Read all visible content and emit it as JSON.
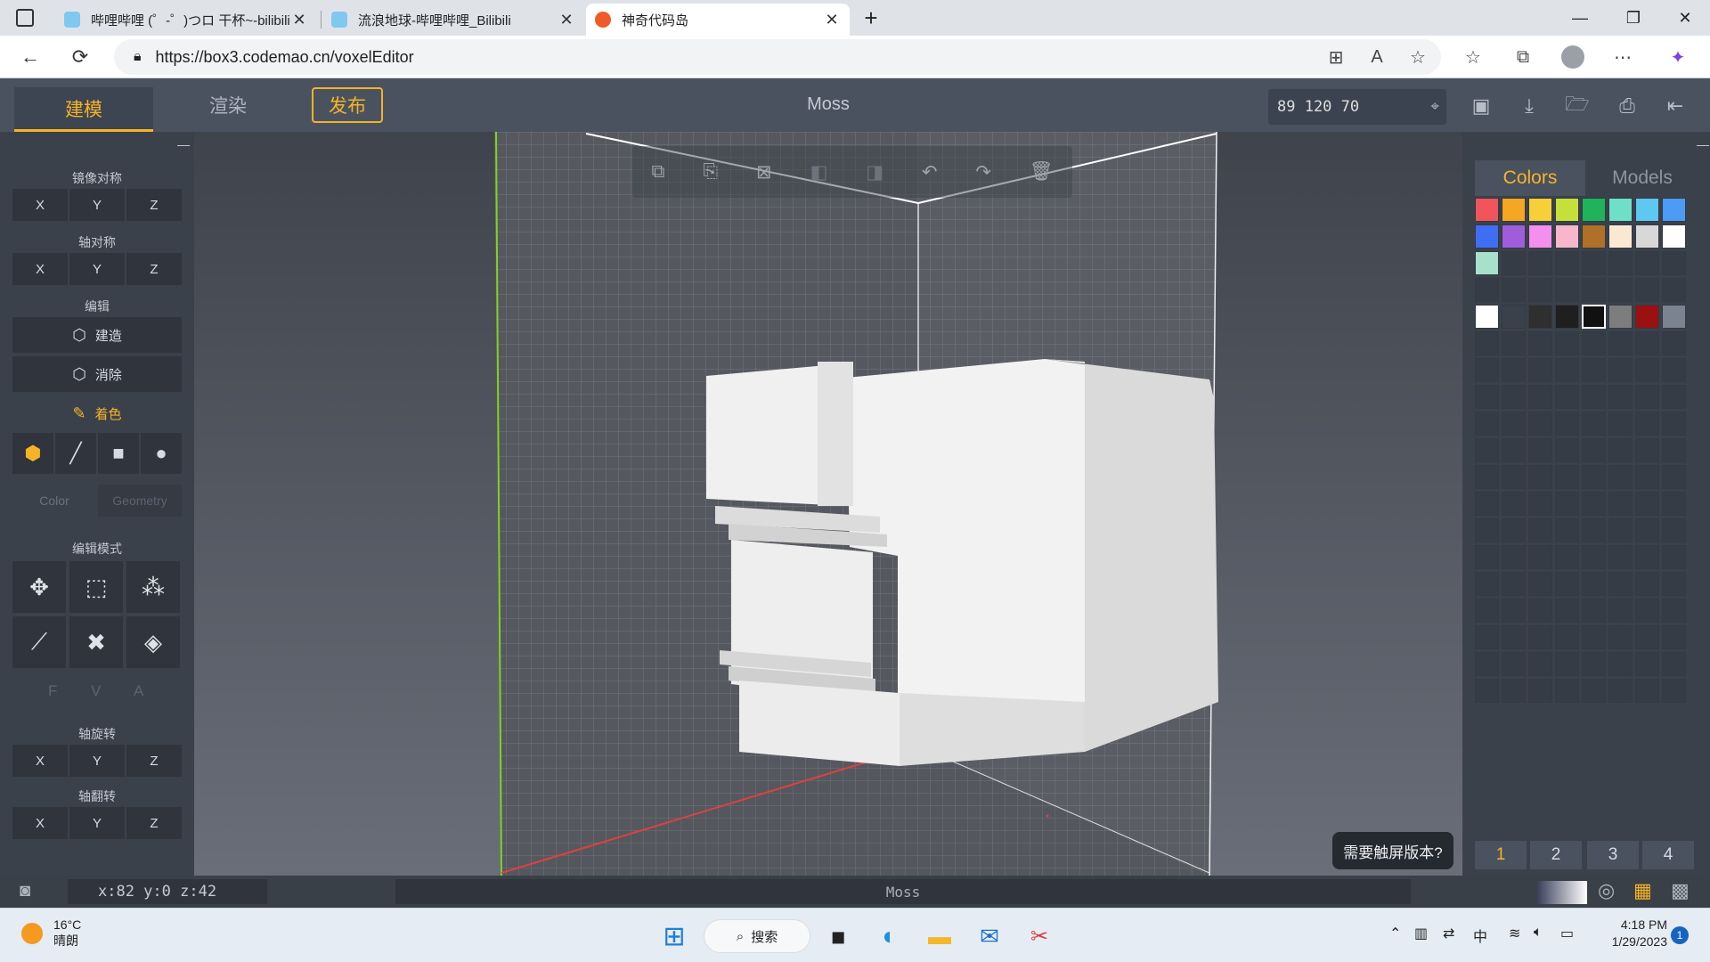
{
  "browser": {
    "tabs": [
      {
        "label": "哔哩哔哩 (゜-゜)つロ 干杯~-bilibili",
        "icon": "bilibili-tv-icon"
      },
      {
        "label": "流浪地球-哔哩哔哩_Bilibili",
        "icon": "bilibili-tv-icon"
      },
      {
        "label": "神奇代码岛",
        "icon": "codemao-star-icon",
        "active": true
      }
    ],
    "new_tab": "+",
    "url": "https://box3.codemao.cn/voxelEditor"
  },
  "app": {
    "modes": {
      "build": "建模",
      "render": "渲染",
      "publish": "发布"
    },
    "project_name": "Moss",
    "cursor_coords": "89 120 70",
    "accent": "#f5b325"
  },
  "left": {
    "mirror_title": "镜像对称",
    "axis_sym_title": "轴对称",
    "edit_title": "编辑",
    "build": "建造",
    "erase": "消除",
    "paint": "着色",
    "brush_labels": {
      "color": "Color",
      "geometry": "Geometry"
    },
    "edit_mode_title": "编辑模式",
    "fva": [
      "F",
      "V",
      "A"
    ],
    "rotate_title": "轴旋转",
    "flip_title": "轴翻转",
    "axes": [
      "X",
      "Y",
      "Z"
    ]
  },
  "right": {
    "tabs": {
      "colors": "Colors",
      "models": "Models"
    },
    "palette_row1": [
      "#f2545b",
      "#f5a623",
      "#f7d038",
      "#c5e03a",
      "#1fb45a",
      "#6ee0c8",
      "#5ec8f0",
      "#4c9bf7"
    ],
    "palette_row2": [
      "#3f6ef5",
      "#a05ddb",
      "#f48ff0",
      "#f7b6cb",
      "#b07028",
      "#fbe8d3",
      "#d8d8d8",
      "#ffffff"
    ],
    "palette_row3": [
      "#a8e0cc"
    ],
    "palette_custom": [
      "#ffffff",
      "#3b414b",
      "#2f2f2f",
      "#1f1f1f",
      "#111111",
      "#7d7d7d",
      "#9b1010",
      "#7b8390"
    ],
    "pages": [
      "1",
      "2",
      "3",
      "4"
    ],
    "touch_prompt": "需要触屏版本?"
  },
  "status": {
    "pos": "x:82 y:0 z:42",
    "name": "Moss"
  },
  "taskbar": {
    "temp": "16°C",
    "weather": "晴朗",
    "search": "搜索",
    "ime": "中",
    "time": "4:18 PM",
    "date": "1/29/2023",
    "badge": "1"
  }
}
